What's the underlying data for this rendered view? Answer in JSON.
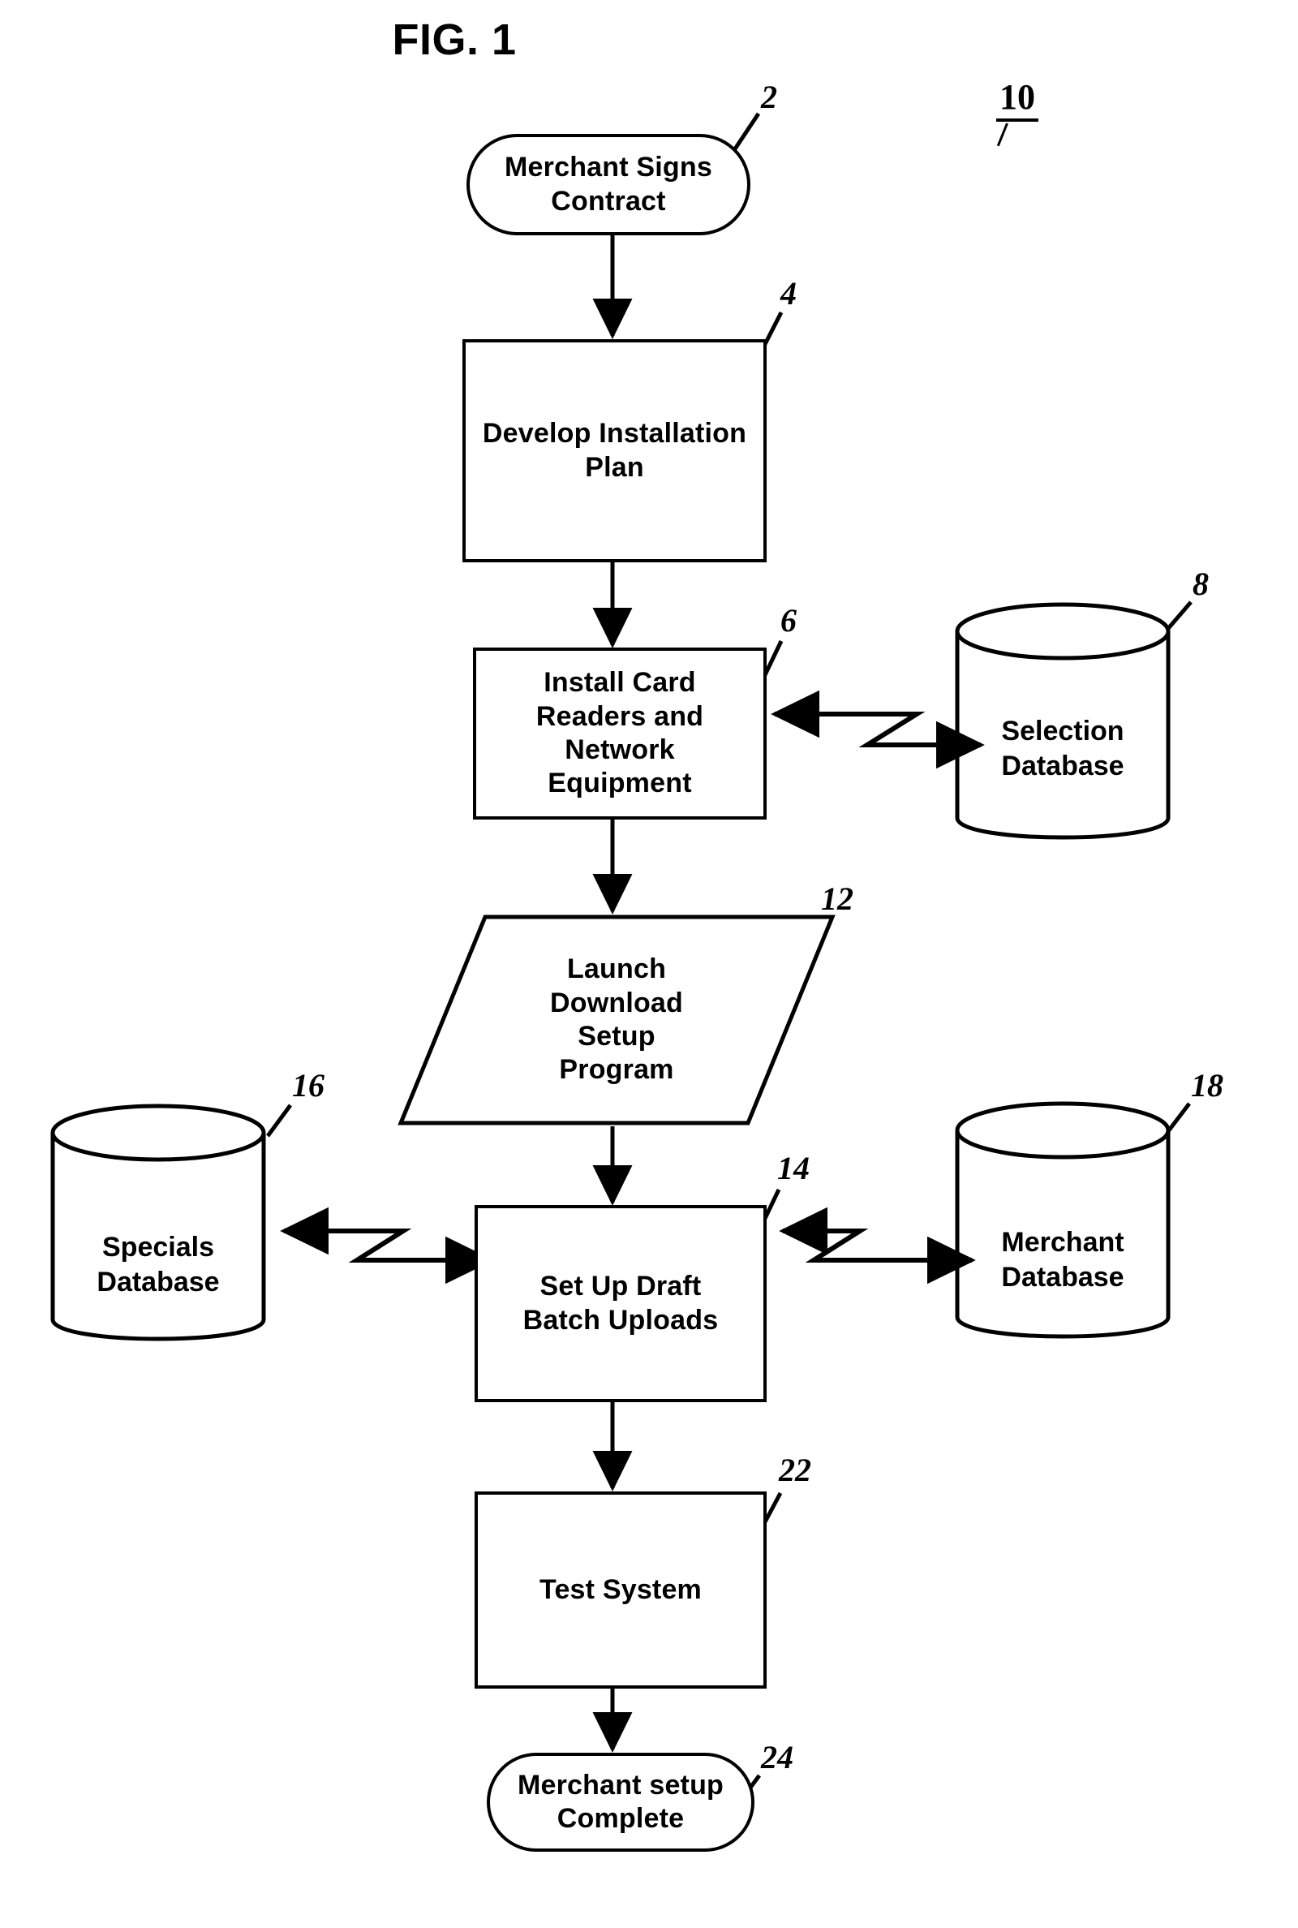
{
  "figure": {
    "title": "FIG. 1",
    "system_ref": "10"
  },
  "nodes": [
    {
      "id": "merchant-signs-contract",
      "shape": "terminator",
      "label": "Merchant Signs\nContract",
      "line1": "Merchant Signs",
      "line2": "Contract",
      "ref": "2"
    },
    {
      "id": "develop-installation-plan",
      "shape": "process",
      "label": "Develop Installation\nPlan",
      "line1": "Develop Installation",
      "line2": "Plan",
      "ref": "4"
    },
    {
      "id": "install-card-readers",
      "shape": "process",
      "label": "Install Card\nReaders and\nNetwork\nEquipment",
      "line1": "Install Card",
      "line2": "Readers and",
      "line3": "Network",
      "line4": "Equipment",
      "ref": "6"
    },
    {
      "id": "selection-database",
      "shape": "database",
      "label": "Selection\nDatabase",
      "line1": "Selection",
      "line2": "Database",
      "ref": "8"
    },
    {
      "id": "launch-download-setup-program",
      "shape": "parallelogram",
      "label": "Launch\nDownload\nSetup\nProgram",
      "line1": "Launch",
      "line2": "Download",
      "line3": "Setup",
      "line4": "Program",
      "ref": "12"
    },
    {
      "id": "specials-database",
      "shape": "database",
      "label": "Specials\nDatabase",
      "line1": "Specials",
      "line2": "Database",
      "ref": "16"
    },
    {
      "id": "set-up-draft-batch-uploads",
      "shape": "process",
      "label": "Set Up Draft\nBatch Uploads",
      "line1": "Set Up Draft",
      "line2": "Batch Uploads",
      "ref": "14"
    },
    {
      "id": "merchant-database",
      "shape": "database",
      "label": "Merchant\nDatabase",
      "line1": "Merchant",
      "line2": "Database",
      "ref": "18"
    },
    {
      "id": "test-system",
      "shape": "process",
      "label": "Test System",
      "line1": "Test System",
      "ref": "22"
    },
    {
      "id": "merchant-setup-complete",
      "shape": "terminator",
      "label": "Merchant setup\nComplete",
      "line1": "Merchant setup",
      "line2": "Complete",
      "ref": "24"
    }
  ],
  "edges": [
    {
      "from": "merchant-signs-contract",
      "to": "develop-installation-plan",
      "type": "arrow-down"
    },
    {
      "from": "develop-installation-plan",
      "to": "install-card-readers",
      "type": "arrow-down"
    },
    {
      "from": "install-card-readers",
      "to": "selection-database",
      "type": "zigzag-bidirectional"
    },
    {
      "from": "install-card-readers",
      "to": "launch-download-setup-program",
      "type": "arrow-down"
    },
    {
      "from": "launch-download-setup-program",
      "to": "set-up-draft-batch-uploads",
      "type": "arrow-down"
    },
    {
      "from": "set-up-draft-batch-uploads",
      "to": "specials-database",
      "type": "zigzag-bidirectional"
    },
    {
      "from": "set-up-draft-batch-uploads",
      "to": "merchant-database",
      "type": "zigzag-bidirectional"
    },
    {
      "from": "set-up-draft-batch-uploads",
      "to": "test-system",
      "type": "arrow-down"
    },
    {
      "from": "test-system",
      "to": "merchant-setup-complete",
      "type": "arrow-down"
    }
  ],
  "colors": {
    "ink": "#000000",
    "paper": "#ffffff"
  }
}
